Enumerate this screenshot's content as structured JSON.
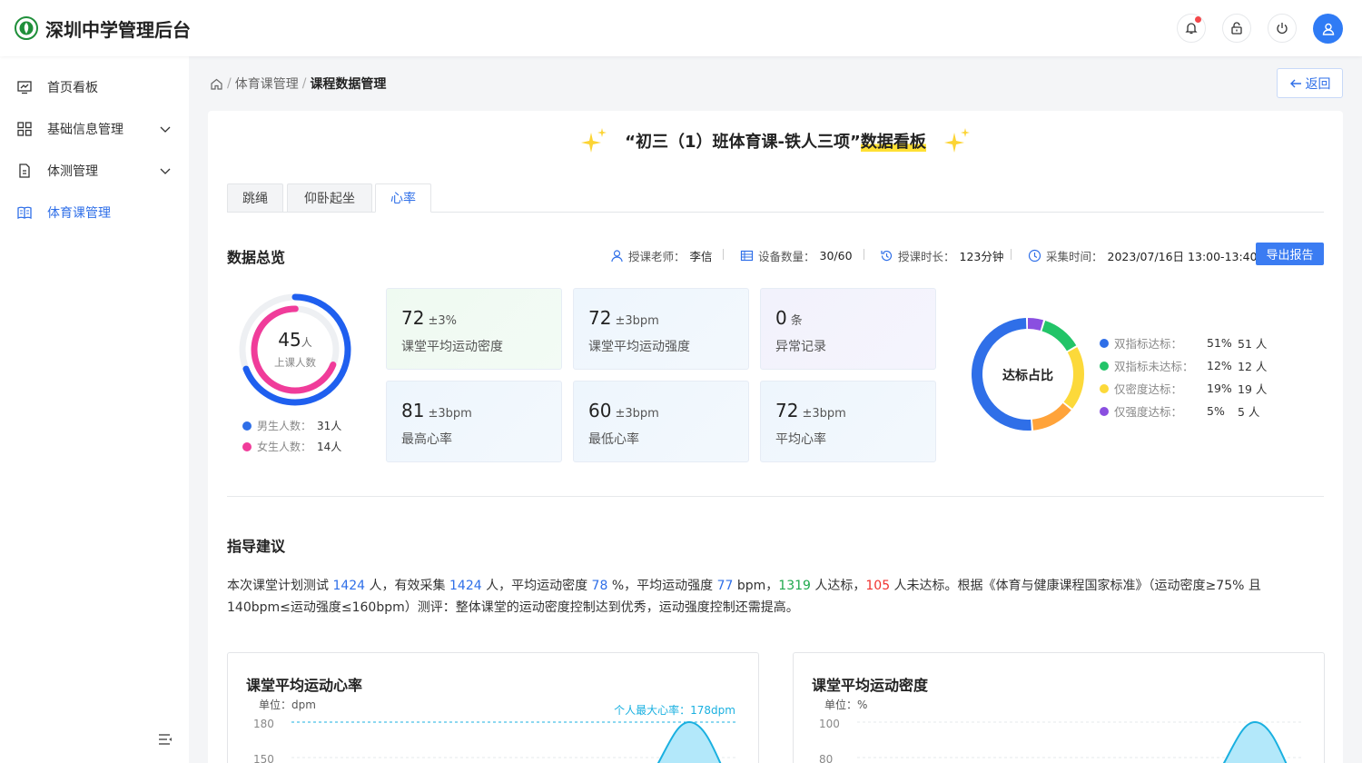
{
  "header": {
    "app_title": "深圳中学管理后台"
  },
  "sidebar": {
    "items": [
      {
        "label": "首页看板"
      },
      {
        "label": "基础信息管理"
      },
      {
        "label": "体测管理"
      },
      {
        "label": "体育课管理"
      }
    ]
  },
  "breadcrumb": {
    "level1": "体育课管理",
    "sep": "/",
    "current": "课程数据管理"
  },
  "back_label": "返回",
  "dashboard": {
    "title_prefix": "“初三（1）班体育课-铁人三项”",
    "title_highlight": "数据看板"
  },
  "tabs": [
    {
      "label": "跳绳"
    },
    {
      "label": "仰卧起坐"
    },
    {
      "label": "心率"
    }
  ],
  "overview": {
    "title": "数据总览",
    "teacher_label": "授课老师：",
    "teacher": "李信",
    "devices_label": "设备数量：",
    "devices": "30/60",
    "duration_label": "授课时长：",
    "duration": "123分钟",
    "time_label": "采集时间：",
    "time": "2023/07/16日 13:00-13:40",
    "export_label": "导出报告"
  },
  "attendance": {
    "count": "45",
    "unit": "人",
    "label": "上课人数",
    "male_label": "男生人数：",
    "male": "31人",
    "female_label": "女生人数：",
    "female": "14人",
    "male_fraction": 0.69,
    "female_fraction": 0.31
  },
  "stats": [
    {
      "value": "72",
      "delta": "±3%",
      "label": "课堂平均运动密度"
    },
    {
      "value": "72",
      "delta": "±3bpm",
      "label": "课堂平均运动强度"
    },
    {
      "value": "0",
      "delta": "条",
      "label": "异常记录"
    },
    {
      "value": "81",
      "delta": "±3bpm",
      "label": "最高心率"
    },
    {
      "value": "60",
      "delta": "±3bpm",
      "label": "最低心率"
    },
    {
      "value": "72",
      "delta": "±3bpm",
      "label": "平均心率"
    }
  ],
  "compliance": {
    "label": "达标占比",
    "items": [
      {
        "name": "双指标达标：",
        "pct": "51%",
        "count": "51 人",
        "color": "#2f6fe8"
      },
      {
        "name": "双指标未达标：",
        "pct": "12%",
        "count": "12 人",
        "color": "#22c468"
      },
      {
        "name": "仅密度达标：",
        "pct": "19%",
        "count": "19 人",
        "color": "#fcd93a"
      },
      {
        "name": "仅强度达标：",
        "pct": "5%",
        "count": "5 人",
        "color": "#8a4fe0"
      }
    ]
  },
  "advice": {
    "title": "指导建议",
    "t1": "本次课堂计划测试 ",
    "n1": "1424",
    "t2": " 人，有效采集 ",
    "n2": "1424",
    "t3": " 人，平均运动密度 ",
    "n3": "78",
    "t4": " %，平均运动强度 ",
    "n4": "77",
    "t5": " bpm，",
    "n5": "1319",
    "t6": " 人达标，",
    "n6": "105",
    "t7": " 人未达标。根据《体育与健康课程国家标准》（运动密度≥75% 且 140bpm≤运动强度≤160bpm）测评：整体课堂的运动密度控制达到优秀，运动强度控制还需提高。"
  },
  "charts": [
    {
      "title": "课堂平均运动心率",
      "unit": "单位：dpm",
      "ticks": [
        "180",
        "150"
      ],
      "annotation": "个人最大心率：178dpm"
    },
    {
      "title": "课堂平均运动密度",
      "unit": "单位：%",
      "ticks": [
        "100",
        "80"
      ]
    }
  ]
}
